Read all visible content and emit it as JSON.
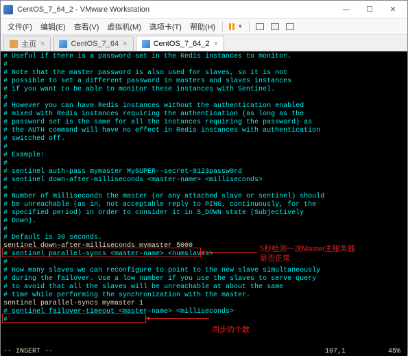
{
  "window": {
    "title": "CentOS_7_64_2 - VMware Workstation",
    "controls": {
      "min": "—",
      "max": "☐",
      "close": "✕"
    }
  },
  "menu": {
    "file": "文件(F)",
    "edit": "编辑(E)",
    "view": "查看(V)",
    "vm": "虚拟机(M)",
    "tabs": "选项卡(T)",
    "help": "帮助(H)"
  },
  "tabs": {
    "home": "主页",
    "t1": "CentOS_7_64",
    "t2": "CentOS_7_64_2"
  },
  "term": {
    "l1": "# Useful if there is a password set in the Redis instances to monitor.",
    "l2": "#",
    "l3": "# Note that the master password is also used for slaves, so it is not",
    "l4": "# possible to set a different password in masters and slaves instances",
    "l5": "# if you want to be able to monitor these instances with Sentinel.",
    "l6": "#",
    "l7": "# However you can have Redis instances without the authentication enabled",
    "l8": "# mixed with Redis instances requiring the authentication (as long as the",
    "l9": "# password set is the same for all the instances requiring the password) as",
    "l10": "# the AUTH command will have no effect in Redis instances with authentication",
    "l11": "# switched off.",
    "l12": "#",
    "l13": "# Example:",
    "l14": "#",
    "l15": "# sentinel auth-pass mymaster MySUPER--secret-0123passw0rd",
    "l16": "",
    "l17": "# sentinel down-after-milliseconds <master-name> <milliseconds>",
    "l18": "#",
    "l19": "# Number of milliseconds the master (or any attached slave or sentinel) should",
    "l20": "# be unreachable (as in, not acceptable reply to PING, continuously, for the",
    "l21": "# specified period) in order to consider it in S_DOWN state (Subjectively",
    "l22": "# Down).",
    "l23": "#",
    "l24": "# Default is 30 seconds.",
    "l25": "sentinel down-after-milliseconds mymaster 5000",
    "l26": "",
    "l27": "# sentinel parallel-syncs <master-name> <numslaves>",
    "l28": "#",
    "l29": "# How many slaves we can reconfigure to point to the new slave simultaneously",
    "l30": "# during the failover. Use a low number if you use the slaves to serve query",
    "l31": "# to avoid that all the slaves will be unreachable at about the same",
    "l32": "# time while performing the synchronization with the master.",
    "l33": "sentinel parallel-syncs mymaster 1",
    "l34": "",
    "l35": "# sentinel failover-timeout <master-name> <milliseconds>",
    "l36": "#",
    "mode": "-- INSERT --",
    "pos": "107,1",
    "pct": "45%"
  },
  "annotations": {
    "a1": "5秒检测一次Master主服务器",
    "a1b": "是否正常",
    "a2": "同步的个数"
  }
}
